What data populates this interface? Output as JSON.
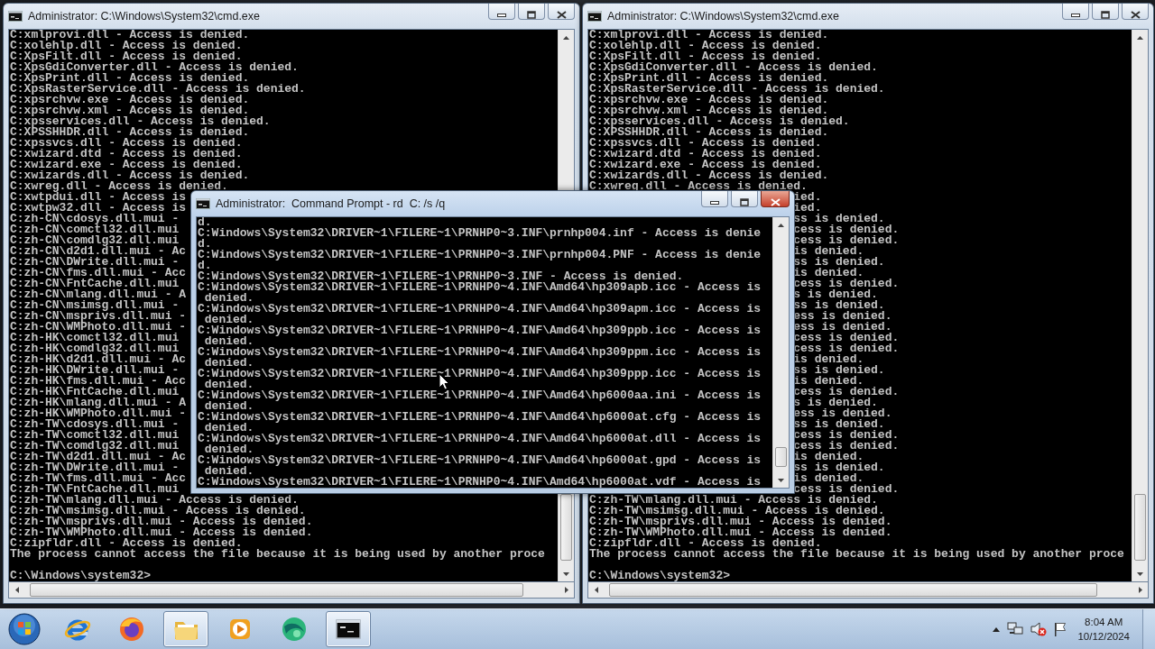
{
  "windows": [
    {
      "title": "Administrator: C:\\Windows\\System32\\cmd.exe",
      "active": false,
      "lines": [
        "C:xmlprovi.dll - Access is denied.",
        "C:xolehlp.dll - Access is denied.",
        "C:XpsFilt.dll - Access is denied.",
        "C:XpsGdiConverter.dll - Access is denied.",
        "C:XpsPrint.dll - Access is denied.",
        "C:XpsRasterService.dll - Access is denied.",
        "C:xpsrchvw.exe - Access is denied.",
        "C:xpsrchvw.xml - Access is denied.",
        "C:xpsservices.dll - Access is denied.",
        "C:XPSSHHDR.dll - Access is denied.",
        "C:xpssvcs.dll - Access is denied.",
        "C:xwizard.dtd - Access is denied.",
        "C:xwizard.exe - Access is denied.",
        "C:xwizards.dll - Access is denied.",
        "C:xwreg.dll - Access is denied.",
        "C:xwtpdui.dll - Access is",
        "C:xwtpw32.dll - Access is",
        "C:zh-CN\\cdosys.dll.mui -",
        "C:zh-CN\\comctl32.dll.mui",
        "C:zh-CN\\comdlg32.dll.mui",
        "C:zh-CN\\d2d1.dll.mui - Ac",
        "C:zh-CN\\DWrite.dll.mui -",
        "C:zh-CN\\fms.dll.mui - Acc",
        "C:zh-CN\\FntCache.dll.mui",
        "C:zh-CN\\mlang.dll.mui - A",
        "C:zh-CN\\msimsg.dll.mui -",
        "C:zh-CN\\msprivs.dll.mui -",
        "C:zh-CN\\WMPhoto.dll.mui -",
        "C:zh-HK\\comctl32.dll.mui",
        "C:zh-HK\\comdlg32.dll.mui",
        "C:zh-HK\\d2d1.dll.mui - Ac",
        "C:zh-HK\\DWrite.dll.mui -",
        "C:zh-HK\\fms.dll.mui - Acc",
        "C:zh-HK\\FntCache.dll.mui",
        "C:zh-HK\\mlang.dll.mui - A",
        "C:zh-HK\\WMPhoto.dll.mui -",
        "C:zh-TW\\cdosys.dll.mui -",
        "C:zh-TW\\comctl32.dll.mui",
        "C:zh-TW\\comdlg32.dll.mui",
        "C:zh-TW\\d2d1.dll.mui - Ac",
        "C:zh-TW\\DWrite.dll.mui -",
        "C:zh-TW\\fms.dll.mui - Acc",
        "C:zh-TW\\FntCache.dll.mui",
        "C:zh-TW\\mlang.dll.mui - Access is denied.",
        "C:zh-TW\\msimsg.dll.mui - Access is denied.",
        "C:zh-TW\\msprivs.dll.mui - Access is denied.",
        "C:zh-TW\\WMPhoto.dll.mui - Access is denied.",
        "C:zipfldr.dll - Access is denied.",
        "The process cannot access the file because it is being used by another proce"
      ],
      "prompt": "C:\\Windows\\system32>"
    },
    {
      "title": "Administrator: C:\\Windows\\System32\\cmd.exe",
      "active": false,
      "lines": [
        {
          "text": "C:xmlprovi.dll - Access is denied.",
          "kind": "full"
        },
        {
          "text": "C:xolehlp.dll - Access is denied.",
          "kind": "full"
        },
        {
          "text": "C:XpsFilt.dll - Access is denied.",
          "kind": "full"
        },
        {
          "text": "C:XpsGdiConverter.dll - Access is denied.",
          "kind": "full"
        },
        {
          "text": "C:XpsPrint.dll - Access is denied.",
          "kind": "full"
        },
        {
          "text": "C:XpsRasterService.dll - Access is denied.",
          "kind": "full"
        },
        {
          "text": "C:xpsrchvw.exe - Access is denied.",
          "kind": "full"
        },
        {
          "text": "C:xpsrchvw.xml - Access is denied.",
          "kind": "full"
        },
        {
          "text": "C:xpsservices.dll - Access is denied.",
          "kind": "full"
        },
        {
          "text": "C:XPSSHHDR.dll - Access is denied.",
          "kind": "full"
        },
        {
          "text": "C:xpssvcs.dll - Access is denied.",
          "kind": "full"
        },
        {
          "text": "C:xwizard.dtd - Access is denied.",
          "kind": "full"
        },
        {
          "text": "C:xwizard.exe - Access is denied.",
          "kind": "full"
        },
        {
          "text": "C:xwizards.dll - Access is denied.",
          "kind": "full"
        },
        {
          "text": "C:xwreg.dll - Access is denied.",
          "kind": "full"
        },
        {
          "text": "ied.",
          "kind": "tail"
        },
        {
          "text": "ied.",
          "kind": "tail"
        },
        {
          "text": "ss is denied.",
          "kind": "tail"
        },
        {
          "text": "cess is denied.",
          "kind": "tail"
        },
        {
          "text": "cess is denied.",
          "kind": "tail"
        },
        {
          "text": "is denied.",
          "kind": "tail"
        },
        {
          "text": "ss is denied.",
          "kind": "tail"
        },
        {
          "text": "is denied.",
          "kind": "tail"
        },
        {
          "text": "cess is denied.",
          "kind": "tail"
        },
        {
          "text": "s is denied.",
          "kind": "tail"
        },
        {
          "text": "ss is denied.",
          "kind": "tail"
        },
        {
          "text": "ess is denied.",
          "kind": "tail"
        },
        {
          "text": "ess is denied.",
          "kind": "tail"
        },
        {
          "text": "cess is denied.",
          "kind": "tail"
        },
        {
          "text": "cess is denied.",
          "kind": "tail"
        },
        {
          "text": "is denied.",
          "kind": "tail"
        },
        {
          "text": "ss is denied.",
          "kind": "tail"
        },
        {
          "text": "is denied.",
          "kind": "tail"
        },
        {
          "text": "cess is denied.",
          "kind": "tail"
        },
        {
          "text": "s is denied.",
          "kind": "tail"
        },
        {
          "text": "ess is denied.",
          "kind": "tail"
        },
        {
          "text": "ss is denied.",
          "kind": "tail"
        },
        {
          "text": "cess is denied.",
          "kind": "tail"
        },
        {
          "text": "cess is denied.",
          "kind": "tail"
        },
        {
          "text": "is denied.",
          "kind": "tail"
        },
        {
          "text": "ss is denied.",
          "kind": "tail"
        },
        {
          "text": "is denied.",
          "kind": "tail"
        },
        {
          "text": "cess is denied.",
          "kind": "tail"
        },
        {
          "text": "C:zh-TW\\mlang.dll.mui - Access is denied.",
          "kind": "full"
        },
        {
          "text": "C:zh-TW\\msimsg.dll.mui - Access is denied.",
          "kind": "full"
        },
        {
          "text": "C:zh-TW\\msprivs.dll.mui - Access is denied.",
          "kind": "full"
        },
        {
          "text": "C:zh-TW\\WMPhoto.dll.mui - Access is denied.",
          "kind": "full"
        },
        {
          "text": "C:zipfldr.dll - Access is denied.",
          "kind": "full"
        },
        {
          "text": "The process cannot access the file because it is being used by another proce",
          "kind": "full"
        }
      ],
      "prompt": "C:\\Windows\\system32>"
    },
    {
      "title": "Administrator:  Command Prompt - rd  C: /s /q",
      "active": true,
      "lines": [
        "d.",
        "C:Windows\\System32\\DRIVER~1\\FILERE~1\\PRNHP0~3.INF\\prnhp004.inf - Access is denie",
        "d.",
        "C:Windows\\System32\\DRIVER~1\\FILERE~1\\PRNHP0~3.INF\\prnhp004.PNF - Access is denie",
        "d.",
        "C:Windows\\System32\\DRIVER~1\\FILERE~1\\PRNHP0~3.INF - Access is denied.",
        "C:Windows\\System32\\DRIVER~1\\FILERE~1\\PRNHP0~4.INF\\Amd64\\hp309apb.icc - Access is",
        " denied.",
        "C:Windows\\System32\\DRIVER~1\\FILERE~1\\PRNHP0~4.INF\\Amd64\\hp309apm.icc - Access is",
        " denied.",
        "C:Windows\\System32\\DRIVER~1\\FILERE~1\\PRNHP0~4.INF\\Amd64\\hp309ppb.icc - Access is",
        " denied.",
        "C:Windows\\System32\\DRIVER~1\\FILERE~1\\PRNHP0~4.INF\\Amd64\\hp309ppm.icc - Access is",
        " denied.",
        "C:Windows\\System32\\DRIVER~1\\FILERE~1\\PRNHP0~4.INF\\Amd64\\hp309ppp.icc - Access is",
        " denied.",
        "C:Windows\\System32\\DRIVER~1\\FILERE~1\\PRNHP0~4.INF\\Amd64\\hp6000aa.ini - Access is",
        " denied.",
        "C:Windows\\System32\\DRIVER~1\\FILERE~1\\PRNHP0~4.INF\\Amd64\\hp6000at.cfg - Access is",
        " denied.",
        "C:Windows\\System32\\DRIVER~1\\FILERE~1\\PRNHP0~4.INF\\Amd64\\hp6000at.dll - Access is",
        " denied.",
        "C:Windows\\System32\\DRIVER~1\\FILERE~1\\PRNHP0~4.INF\\Amd64\\hp6000at.gpd - Access is",
        " denied.",
        "C:Windows\\System32\\DRIVER~1\\FILERE~1\\PRNHP0~4.INF\\Amd64\\hp6000at.vdf - Access is"
      ]
    }
  ],
  "taskbar": {
    "apps": [
      {
        "kind": "browser-e",
        "open": false
      },
      {
        "kind": "fox",
        "open": false
      },
      {
        "kind": "folder",
        "open": true
      },
      {
        "kind": "media",
        "open": false
      },
      {
        "kind": "sphere",
        "open": false
      },
      {
        "kind": "console",
        "open": true
      }
    ],
    "tray": {
      "volume_muted": true,
      "time": "8:04 AM",
      "date": "10/12/2024"
    }
  }
}
